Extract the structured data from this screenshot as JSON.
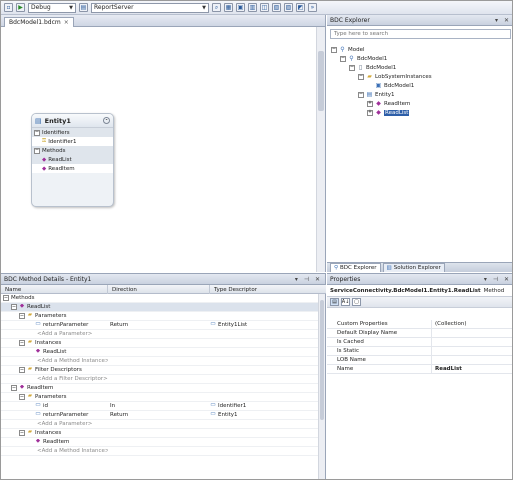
{
  "toolbar": {
    "config_value": "Debug",
    "server_value": "ReportServer"
  },
  "designer": {
    "tab_label": "BdcModel1.bdcm"
  },
  "entity": {
    "title": "Entity1",
    "sections": [
      {
        "label": "Identifiers",
        "items": [
          "Identifier1"
        ]
      },
      {
        "label": "Methods",
        "items": [
          "ReadList",
          "ReadItem"
        ]
      }
    ]
  },
  "explorer": {
    "title": "BDC Explorer",
    "search_placeholder": "Type here to search",
    "tree": [
      {
        "label": "Model",
        "icon": "model-icon",
        "expander": "−"
      },
      {
        "label": "BdcModel1",
        "icon": "model-icon",
        "expander": "−"
      },
      {
        "label": "BdcModel1",
        "icon": "document-icon",
        "expander": "−"
      },
      {
        "label": "LobSystemInstances",
        "icon": "folder-icon",
        "expander": "−"
      },
      {
        "label": "BdcModel1",
        "icon": "instance-icon",
        "expander": ""
      },
      {
        "label": "Entity1",
        "icon": "entity-icon",
        "expander": "−"
      },
      {
        "label": "ReadItem",
        "icon": "method-icon",
        "expander": "+"
      },
      {
        "label": "ReadList",
        "icon": "method-icon",
        "expander": "+"
      }
    ],
    "tabs": [
      "BDC Explorer",
      "Solution Explorer"
    ]
  },
  "method_details": {
    "title": "BDC Method Details - Entity1",
    "columns": [
      "Name",
      "Direction",
      "Type Descriptor"
    ],
    "rows": [
      {
        "name": "Methods",
        "dir": "",
        "type": "",
        "icon": "",
        "add": false
      },
      {
        "name": "ReadList",
        "dir": "",
        "type": "",
        "icon": "method-icon",
        "add": false
      },
      {
        "name": "Parameters",
        "dir": "",
        "type": "",
        "icon": "folder-icon",
        "add": false
      },
      {
        "name": "returnParameter",
        "dir": "Return",
        "type": "Entity1List",
        "icon": "parameter-icon",
        "add": false
      },
      {
        "name": "<Add a Parameter>",
        "dir": "",
        "type": "",
        "icon": "",
        "add": true
      },
      {
        "name": "Instances",
        "dir": "",
        "type": "",
        "icon": "folder-icon",
        "add": false
      },
      {
        "name": "ReadList",
        "dir": "",
        "type": "",
        "icon": "method-icon",
        "add": false
      },
      {
        "name": "<Add a Method Instance>",
        "dir": "",
        "type": "",
        "icon": "",
        "add": true
      },
      {
        "name": "Filter Descriptors",
        "dir": "",
        "type": "",
        "icon": "folder-icon",
        "add": false
      },
      {
        "name": "<Add a Filter Descriptor>",
        "dir": "",
        "type": "",
        "icon": "",
        "add": true
      },
      {
        "name": "ReadItem",
        "dir": "",
        "type": "",
        "icon": "method-icon",
        "add": false
      },
      {
        "name": "Parameters",
        "dir": "",
        "type": "",
        "icon": "folder-icon",
        "add": false
      },
      {
        "name": "id",
        "dir": "In",
        "type": "Identifier1",
        "icon": "parameter-icon",
        "add": false
      },
      {
        "name": "returnParameter",
        "dir": "Return",
        "type": "Entity1",
        "icon": "parameter-icon",
        "add": false
      },
      {
        "name": "<Add a Parameter>",
        "dir": "",
        "type": "",
        "icon": "",
        "add": true
      },
      {
        "name": "Instances",
        "dir": "",
        "type": "",
        "icon": "folder-icon",
        "add": false
      },
      {
        "name": "ReadItem",
        "dir": "",
        "type": "",
        "icon": "method-icon",
        "add": false
      },
      {
        "name": "<Add a Method Instance>",
        "dir": "",
        "type": "",
        "icon": "",
        "add": true
      }
    ]
  },
  "properties": {
    "title": "Properties",
    "object_name": "ServiceConnectivity.BdcModel1.Entity1.ReadList",
    "object_type": "Method",
    "rows": [
      {
        "key": "Custom Properties",
        "value": "(Collection)",
        "bold": false
      },
      {
        "key": "Default Display Name",
        "value": "",
        "bold": false
      },
      {
        "key": "Is Cached",
        "value": "",
        "bold": false
      },
      {
        "key": "Is Static",
        "value": "",
        "bold": false
      },
      {
        "key": "LOB Name",
        "value": "",
        "bold": false
      },
      {
        "key": "Name",
        "value": "ReadList",
        "bold": true
      }
    ]
  }
}
